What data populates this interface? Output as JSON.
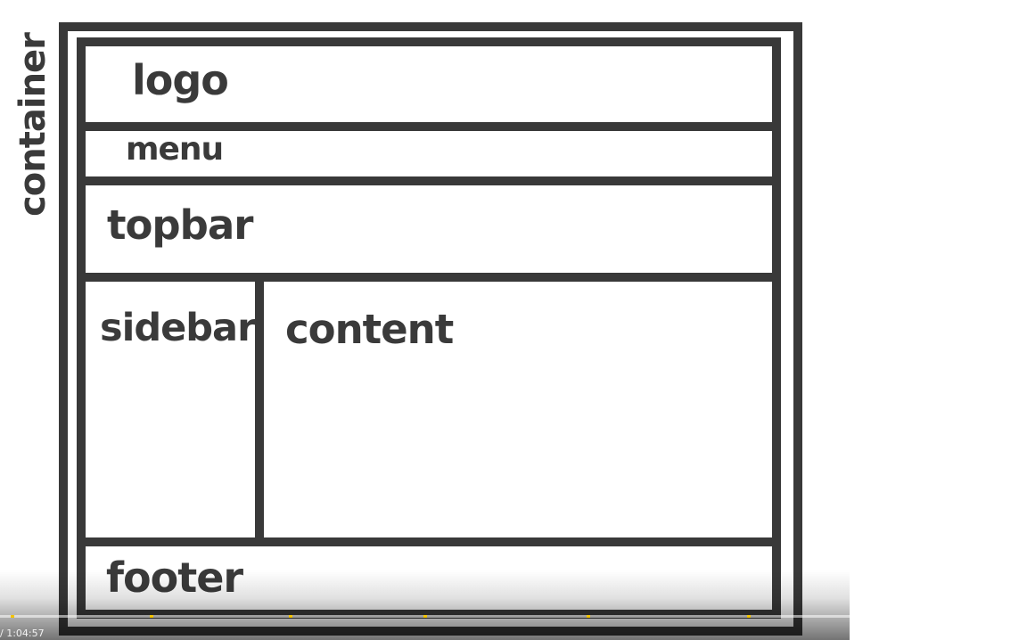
{
  "diagram": {
    "container_label": "container",
    "regions": {
      "logo": "logo",
      "menu": "menu",
      "topbar": "topbar",
      "sidebar": "sidebar",
      "content": "content",
      "footer": "footer"
    }
  },
  "player": {
    "time": "/ 1:04:57"
  },
  "colors": {
    "border": "#393939",
    "text": "#3a3a3a",
    "background": "#ffffff",
    "marker": "#f3c400"
  }
}
